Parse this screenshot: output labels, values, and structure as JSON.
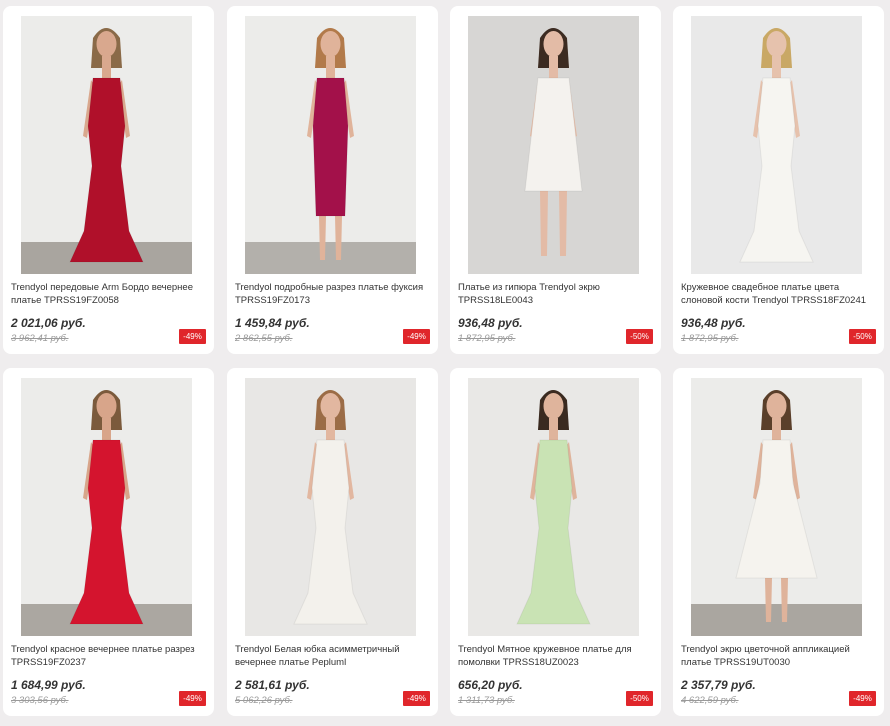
{
  "products": [
    {
      "title": "Trendyol передовые Arm Бордо вечернее платье TPRSS19FZ0058",
      "price": "2 021,06 руб.",
      "old_price": "3 962,41 руб.",
      "discount": "-49%",
      "bg": "#ececea",
      "floor": "#a9a59f",
      "dress": "#b0102a",
      "skin": "#d9a88e",
      "hair": "#8a6a48",
      "style": "gown",
      "image_icon": "red-evening-gown-image"
    },
    {
      "title": "Trendyol подробные разрез платье фуксия TPRSS19FZ0173",
      "price": "1 459,84 руб.",
      "old_price": "2 862,55 руб.",
      "discount": "-49%",
      "bg": "#ececea",
      "floor": "#b3b0ab",
      "dress": "#a3114a",
      "skin": "#e0b39a",
      "hair": "#b27a4a",
      "style": "midi",
      "image_icon": "fuchsia-dress-image"
    },
    {
      "title": "Платье из гипюра Trendyol экрю TPRSS18LE0043",
      "price": "936,48 руб.",
      "old_price": "1 872,95 руб.",
      "discount": "-50%",
      "bg": "#d7d6d4",
      "floor": "#d7d6d4",
      "dress": "#f4f2ee",
      "skin": "#e3bba6",
      "hair": "#3c2b21",
      "style": "short",
      "image_icon": "lace-white-dress-image"
    },
    {
      "title": "Кружевное свадебное платье цвета слоновой кости Trendyol TPRSS18FZ0241",
      "price": "936,48 руб.",
      "old_price": "1 872,95 руб.",
      "discount": "-50%",
      "bg": "#e9e9e9",
      "floor": "#e9e9e9",
      "dress": "#f6f5f1",
      "skin": "#e6c2ad",
      "hair": "#c9a865",
      "style": "gown",
      "image_icon": "ivory-wedding-dress-image"
    },
    {
      "title": "Trendyol красное вечернее платье разрез TPRSS19FZ0237",
      "price": "1 684,99 руб.",
      "old_price": "3 303,56 руб.",
      "discount": "-49%",
      "bg": "#ececea",
      "floor": "#aba7a1",
      "dress": "#d4142e",
      "skin": "#d8a58a",
      "hair": "#7b5a3c",
      "style": "gown",
      "image_icon": "red-slit-gown-image"
    },
    {
      "title": "Trendyol Белая юбка асимметричный вечернее платье Pepluml",
      "price": "2 581,61 руб.",
      "old_price": "5 062,26 руб.",
      "discount": "-49%",
      "bg": "#e8e7e5",
      "floor": "#e8e7e5",
      "dress": "#f3f1ec",
      "skin": "#e2b7a0",
      "hair": "#9b6c46",
      "style": "gown",
      "image_icon": "white-peplum-dress-image"
    },
    {
      "title": "Trendyol Мятное кружевное платье для помолвки TPRSS18UZ0023",
      "price": "656,20 руб.",
      "old_price": "1 311,73 руб.",
      "discount": "-50%",
      "bg": "#e9e8e6",
      "floor": "#e9e8e6",
      "dress": "#c9e3b4",
      "skin": "#dfb49c",
      "hair": "#3a2a20",
      "style": "gown",
      "image_icon": "mint-lace-gown-image"
    },
    {
      "title": "Trendyol экрю цветочной аппликацией платье TPRSS19UT0030",
      "price": "2 357,79 руб.",
      "old_price": "4 622,59 руб.",
      "discount": "-49%",
      "bg": "#ececea",
      "floor": "#aaa6a0",
      "dress": "#f5f3ee",
      "skin": "#dfb39b",
      "hair": "#5a3f2a",
      "style": "midi-flare",
      "image_icon": "ecru-flower-dress-image"
    }
  ]
}
